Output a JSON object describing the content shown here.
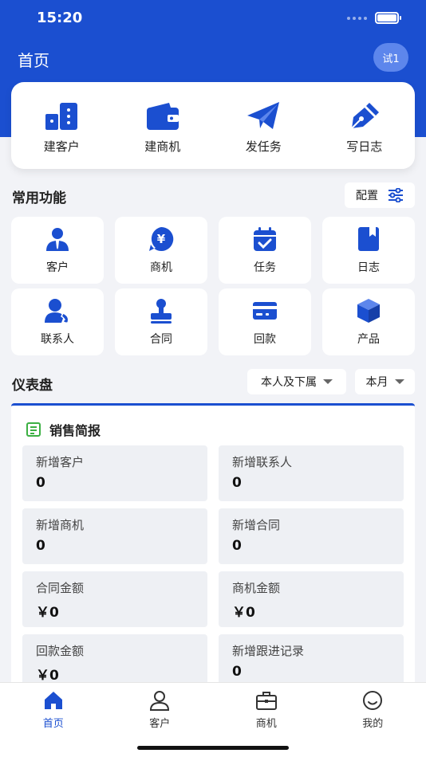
{
  "status": {
    "time": "15:20"
  },
  "header": {
    "title": "首页",
    "trial_badge": "试1"
  },
  "quick_actions": [
    {
      "label": "建客户",
      "icon": "building-icon"
    },
    {
      "label": "建商机",
      "icon": "wallet-icon"
    },
    {
      "label": "发任务",
      "icon": "paper-plane-icon"
    },
    {
      "label": "写日志",
      "icon": "pen-icon"
    }
  ],
  "common": {
    "title": "常用功能",
    "config_label": "配置",
    "items": [
      {
        "label": "客户",
        "icon": "customer-icon"
      },
      {
        "label": "商机",
        "icon": "yen-chat-icon"
      },
      {
        "label": "任务",
        "icon": "calendar-check-icon"
      },
      {
        "label": "日志",
        "icon": "notebook-icon"
      },
      {
        "label": "联系人",
        "icon": "contact-phone-icon"
      },
      {
        "label": "合同",
        "icon": "stamp-icon"
      },
      {
        "label": "回款",
        "icon": "card-icon"
      },
      {
        "label": "产品",
        "icon": "cube-icon"
      }
    ]
  },
  "dashboard": {
    "title": "仪表盘",
    "scope_filter": "本人及下属",
    "period_filter": "本月",
    "report_title": "销售简报",
    "stats": [
      {
        "label": "新增客户",
        "value": "0"
      },
      {
        "label": "新增联系人",
        "value": "0"
      },
      {
        "label": "新增商机",
        "value": "0"
      },
      {
        "label": "新增合同",
        "value": "0"
      },
      {
        "label": "合同金额",
        "value": "￥0"
      },
      {
        "label": "商机金额",
        "value": "￥0"
      },
      {
        "label": "回款金额",
        "value": "￥0"
      },
      {
        "label": "新增跟进记录",
        "value": "0"
      }
    ]
  },
  "tabs": [
    {
      "label": "首页",
      "icon": "home-icon",
      "active": true
    },
    {
      "label": "客户",
      "icon": "user-icon",
      "active": false
    },
    {
      "label": "商机",
      "icon": "briefcase-icon",
      "active": false
    },
    {
      "label": "我的",
      "icon": "smile-icon",
      "active": false
    }
  ],
  "colors": {
    "primary": "#1b4fd0",
    "report_icon": "#3cb043"
  }
}
